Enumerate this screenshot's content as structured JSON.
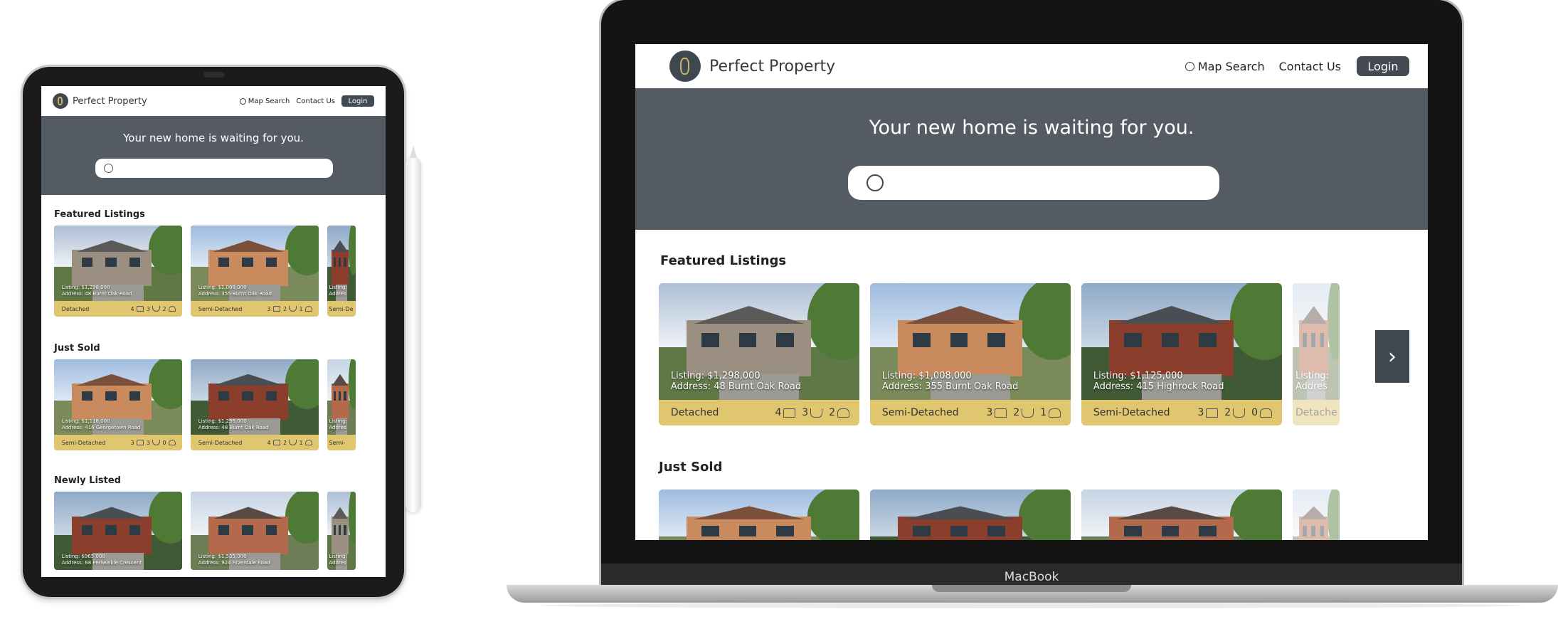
{
  "site": {
    "brand": "Perfect Property",
    "nav": {
      "map_search": "Map Search",
      "contact": "Contact Us",
      "login": "Login"
    },
    "hero_title": "Your new home is waiting for you.",
    "search_placeholder": ""
  },
  "device_label": "MacBook",
  "sections": {
    "featured": "Featured Listings",
    "sold": "Just Sold",
    "newly": "Newly Listed"
  },
  "mac": {
    "featured": [
      {
        "listing": "Listing: $1,298,000",
        "address": "Address: 48 Burnt Oak Road",
        "type": "Detached",
        "beds": "4",
        "baths": "3",
        "garage": "2"
      },
      {
        "listing": "Listing: $1,008,000",
        "address": "Address: 355 Burnt Oak Road",
        "type": "Semi-Detached",
        "beds": "3",
        "baths": "2",
        "garage": "1"
      },
      {
        "listing": "Listing: $1,125,000",
        "address": "Address: 415 Highrock Road",
        "type": "Semi-Detached",
        "beds": "3",
        "baths": "2",
        "garage": "0"
      },
      {
        "listing": "Listing:",
        "address": "Addres",
        "type": "Detache"
      }
    ]
  },
  "ipad": {
    "featured": [
      {
        "listing": "Listing: $1,298,000",
        "address": "Address: 48 Burnt Oak Road",
        "type": "Detached",
        "beds": "4",
        "baths": "3",
        "garage": "2"
      },
      {
        "listing": "Listing: $1,008,000",
        "address": "Address: 355 Burnt Oak Road",
        "type": "Semi-Detached",
        "beds": "3",
        "baths": "2",
        "garage": "1"
      },
      {
        "listing": "Listing:",
        "address": "Addres",
        "type": "Semi-De"
      }
    ],
    "sold": [
      {
        "listing": "Listing: $1,118,000",
        "address": "Address: 416 Georgetown Road",
        "type": "Semi-Detached",
        "beds": "3",
        "baths": "3",
        "garage": "0"
      },
      {
        "listing": "Listing: $1,298,000",
        "address": "Address: 48 Burnt Oak Road",
        "type": "Semi-Detached",
        "beds": "4",
        "baths": "2",
        "garage": "1"
      },
      {
        "listing": "Listing:",
        "address": "Addres",
        "type": "Semi-"
      }
    ],
    "newly": [
      {
        "listing": "Listing: $965,000",
        "address": "Address: 68 Periwinkle Crescent"
      },
      {
        "listing": "Listing: $1,535,000",
        "address": "Address: 924 Riverdale Road"
      },
      {
        "listing": "Listing:",
        "address": "Addres"
      }
    ]
  },
  "colors": {
    "hero": "#545b63",
    "card_strip": "#e0c66f",
    "login": "#434a52"
  },
  "icons": [
    "search-icon",
    "bed-icon",
    "bath-icon",
    "garage-icon",
    "chevron-right-icon"
  ]
}
